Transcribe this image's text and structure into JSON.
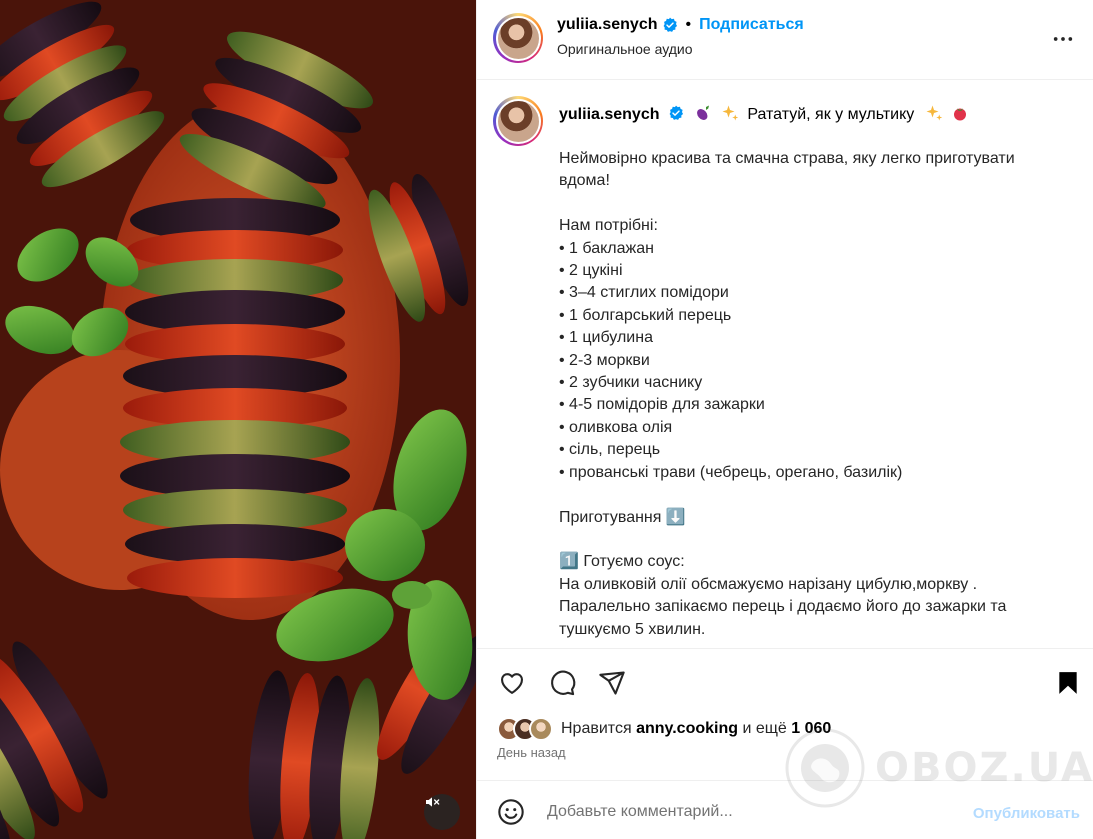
{
  "post": {
    "username": "yuliia.senych",
    "follow_label": "Подписаться",
    "audio_label": "Оригинальное аудио",
    "caption_title_text": "Рататуй, як у мультику",
    "caption_title_emojis": [
      "eggplant",
      "sparkles",
      "sparkles",
      "tomato"
    ],
    "caption_body": "Неймовірно красива та смачна страва, яку легко приготувати вдома!\n\nНам потрібні:\n• 1 баклажан\n• 2 цукіні\n• 3–4 стиглих помідори\n• 1 болгарський перець\n• 1 цибулина\n• 2-3 моркви\n• 2 зубчики часнику\n• 4-5 помідорів для зажарки\n• оливкова олія\n• сіль, перець\n• прованські трави (чебрець, орегано, базилік)\n\nПриготування ⬇️\n\n1️⃣ Готуємо соус:\nНа оливковій олії обсмажуємо нарізану цибулю,моркву .\nПаралельно запікаємо перець і додаємо його до зажарки та тушкуємо 5 хвилин."
  },
  "likes": {
    "prefix": "Нравится",
    "user": "anny.cooking",
    "connector": "и ещё",
    "count": "1 060"
  },
  "timestamp": "День назад",
  "comment": {
    "placeholder": "Добавьте комментарий...",
    "post_label": "Опубликовать"
  },
  "watermark": "OBOZ.UA",
  "colors": {
    "accent": "#0095f6",
    "verified": "#0095f6",
    "post_disabled": "#b3dbff",
    "text_secondary": "#737373"
  },
  "icons": {
    "like": "heart-icon",
    "comment": "comment-icon",
    "share": "send-icon",
    "save": "bookmark-icon",
    "more": "more-options-icon",
    "emoji": "emoji-icon",
    "mute": "speaker-muted-icon"
  }
}
